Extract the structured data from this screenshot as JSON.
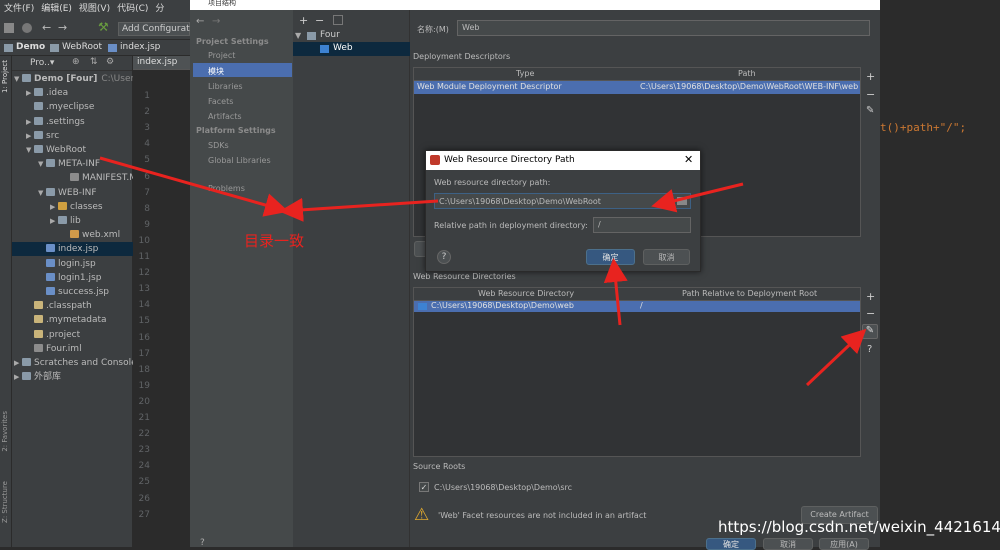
{
  "ide": {
    "menu": [
      "文件(F)",
      "编辑(E)",
      "视图(V)",
      "代码(C)",
      "分"
    ],
    "toolbar": {
      "run_config": "Add Configuratio"
    },
    "breadcrumb": [
      "Demo",
      "WebRoot",
      "index.jsp"
    ],
    "project_tab": "Pro..▾",
    "editor_tab": "index.jsp",
    "side_tabs": [
      "1: Project",
      "2: Favorites",
      "Z: Structure"
    ],
    "tree": [
      {
        "label": "Demo [Four]",
        "suffix": "C:\\Users\\1",
        "indent": 0,
        "fold": "▼",
        "icon": "folder"
      },
      {
        "label": ".idea",
        "indent": 1,
        "fold": "▶",
        "icon": "folder"
      },
      {
        "label": ".myeclipse",
        "indent": 1,
        "fold": "",
        "icon": "folder"
      },
      {
        "label": ".settings",
        "indent": 1,
        "fold": "▶",
        "icon": "folder"
      },
      {
        "label": "src",
        "indent": 1,
        "fold": "▶",
        "icon": "folder"
      },
      {
        "label": "WebRoot",
        "indent": 1,
        "fold": "▼",
        "icon": "folder"
      },
      {
        "label": "META-INF",
        "indent": 2,
        "fold": "▼",
        "icon": "folder"
      },
      {
        "label": "MANIFEST.MF",
        "indent": 4,
        "fold": "",
        "icon": "file"
      },
      {
        "label": "WEB-INF",
        "indent": 2,
        "fold": "▼",
        "icon": "folder"
      },
      {
        "label": "classes",
        "indent": 3,
        "fold": "▶",
        "icon": "folder-orange"
      },
      {
        "label": "lib",
        "indent": 3,
        "fold": "▶",
        "icon": "folder"
      },
      {
        "label": "web.xml",
        "indent": 4,
        "fold": "",
        "icon": "xml"
      },
      {
        "label": "index.jsp",
        "indent": 2,
        "fold": "",
        "icon": "jsp",
        "selected": true
      },
      {
        "label": "login.jsp",
        "indent": 2,
        "fold": "",
        "icon": "jsp"
      },
      {
        "label": "login1.jsp",
        "indent": 2,
        "fold": "",
        "icon": "jsp"
      },
      {
        "label": "success.jsp",
        "indent": 2,
        "fold": "",
        "icon": "jsp"
      },
      {
        "label": ".classpath",
        "indent": 1,
        "fold": "",
        "icon": "dot"
      },
      {
        "label": ".mymetadata",
        "indent": 1,
        "fold": "",
        "icon": "dot"
      },
      {
        "label": ".project",
        "indent": 1,
        "fold": "",
        "icon": "dot"
      },
      {
        "label": "Four.iml",
        "indent": 1,
        "fold": "",
        "icon": "iml"
      },
      {
        "label": "Scratches and Consoles",
        "indent": 0,
        "fold": "▶",
        "icon": "folder"
      },
      {
        "label": "外部库",
        "indent": 0,
        "fold": "▶",
        "icon": "lib"
      }
    ],
    "line_numbers": [
      "1",
      "2",
      "3",
      "4",
      "5",
      "6",
      "7",
      "8",
      "9",
      "10",
      "11",
      "12",
      "13",
      "14",
      "15",
      "16",
      "17",
      "18",
      "19",
      "20",
      "21",
      "22",
      "23",
      "24",
      "25",
      "26",
      "27"
    ],
    "code_snippet": "t()+path+\"/\";"
  },
  "dialog": {
    "title": "项目结构",
    "sidebar": {
      "project_settings_header": "Project Settings",
      "project_settings": [
        "Project",
        "模块",
        "Libraries",
        "Facets",
        "Artifacts"
      ],
      "platform_settings_header": "Platform Settings",
      "platform_settings": [
        "SDKs",
        "Global Libraries"
      ],
      "problems": "Problems"
    },
    "modules": {
      "root": "Four",
      "child": "Web"
    },
    "name_label": "名称:(M)",
    "name_value": "Web",
    "deployment_descriptors": {
      "heading": "Deployment Descriptors",
      "columns": [
        "Type",
        "Path"
      ],
      "rows": [
        [
          "Web Module Deployment Descriptor",
          "C:\\Users\\19068\\Desktop\\Demo\\WebRoot\\WEB-INF\\web"
        ]
      ]
    },
    "web_resource_directories": {
      "heading": "Web Resource Directories",
      "columns": [
        "Web Resource Directory",
        "Path Relative to Deployment Root"
      ],
      "rows": [
        [
          "C:\\Users\\19068\\Desktop\\Demo\\web",
          "/"
        ]
      ]
    },
    "source_roots": {
      "heading": "Source Roots",
      "item": "C:\\Users\\19068\\Desktop\\Demo\\src",
      "checked": true
    },
    "warning": "'Web' Facet resources are not included in an artifact",
    "create_artifact_label": "Create Artifact",
    "footer_buttons": [
      "确定",
      "取消",
      "应用(A)"
    ]
  },
  "popup": {
    "title": "Web Resource Directory Path",
    "path_label": "Web resource directory path:",
    "path_value": "C:\\Users\\19068\\Desktop\\Demo\\WebRoot",
    "relative_label": "Relative path in deployment directory:",
    "relative_value": "/",
    "ok_label": "确定",
    "cancel_label": "取消",
    "help_label": "?"
  },
  "annotation": {
    "text": "目录一致",
    "color": "#e8231f"
  },
  "watermark": "https://blog.csdn.net/weixin_44216144",
  "colors": {
    "selection": "#4b6eaf",
    "primary_button": "#365880",
    "arrow": "#e8231f"
  }
}
